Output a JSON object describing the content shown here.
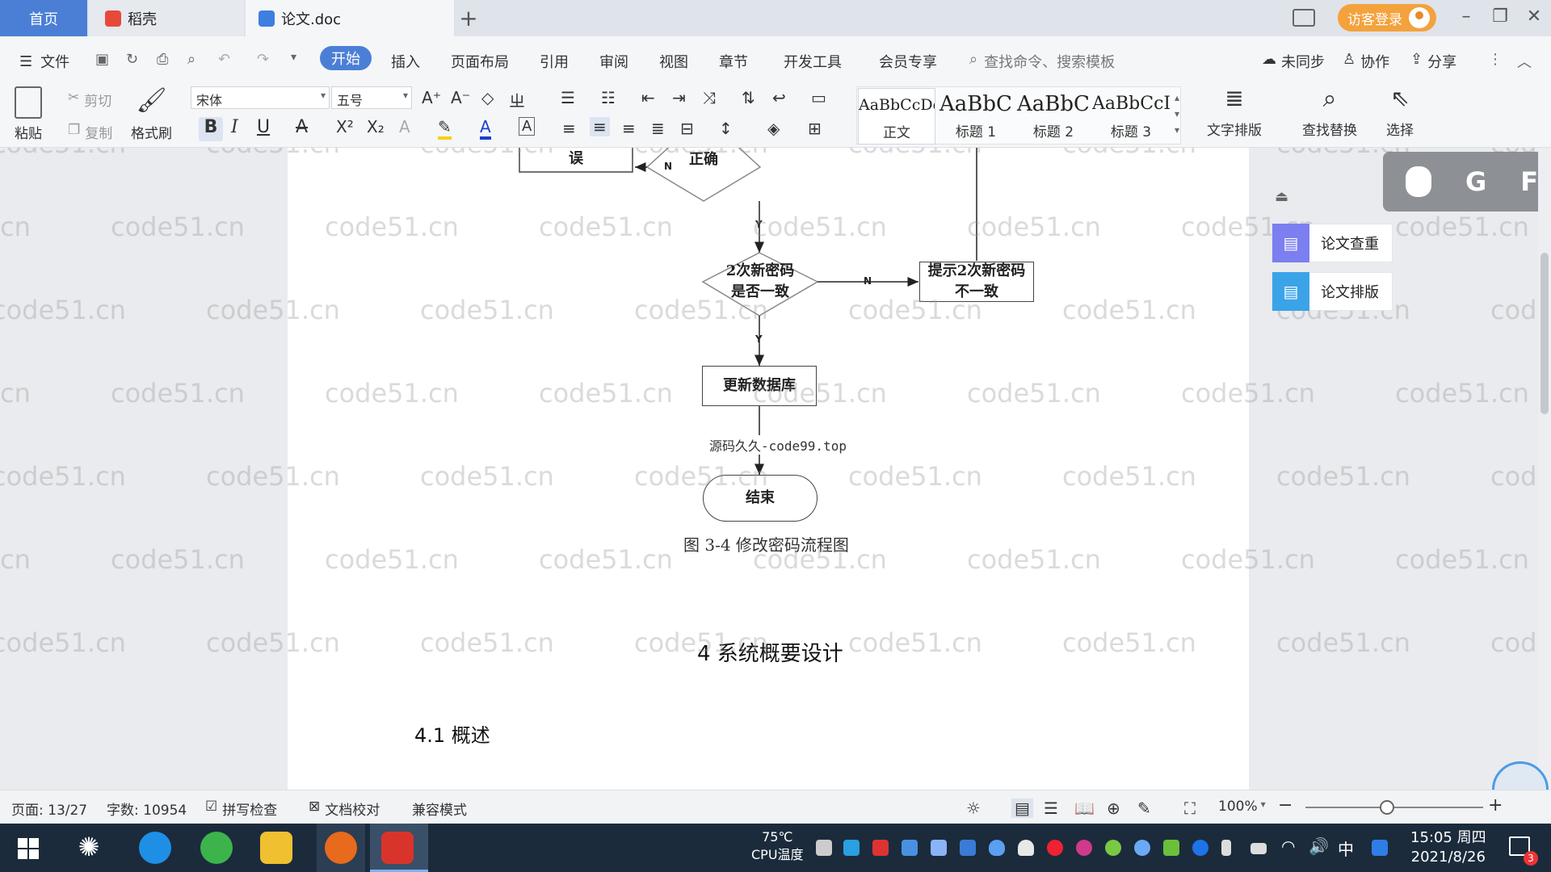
{
  "tabs": {
    "home": "首页",
    "daoke": "稻壳",
    "doc": "论文.doc",
    "add": "+"
  },
  "titlebar": {
    "login": "访客登录"
  },
  "menu": {
    "file": "文件",
    "items": [
      "开始",
      "插入",
      "页面布局",
      "引用",
      "审阅",
      "视图",
      "章节",
      "开发工具",
      "会员专享"
    ],
    "search_placeholder": "查找命令、搜索模板",
    "sync": "未同步",
    "collab": "协作",
    "share": "分享"
  },
  "ribbon": {
    "paste": "粘贴",
    "cut": "剪切",
    "copy": "复制",
    "format_painter": "格式刷",
    "font_name": "宋体",
    "font_size": "五号",
    "styles": [
      {
        "sample": "AaBbCcDd",
        "label": "正文"
      },
      {
        "sample": "AaBbC",
        "label": "标题 1"
      },
      {
        "sample": "AaBbC",
        "label": "标题 2"
      },
      {
        "sample": "AaBbCcI",
        "label": "标题 3"
      }
    ],
    "text_layout": "文字排版",
    "find_replace": "查找替换",
    "select": "选择"
  },
  "watermark": "code51.cn",
  "flowchart": {
    "top_box": "误",
    "top_diamond": "正确",
    "diamond2": "2次新密码\n是否一致",
    "alert_box": "提示2次新密码\n不一致",
    "update_box": "更新数据库",
    "end": "结束",
    "label_y": "Y",
    "label_n": "N",
    "source_note": "源码久久-code99.top"
  },
  "document": {
    "figure_caption": "图 3-4 修改密码流程图",
    "heading": "4 系统概要设计",
    "subheading": "4.1 概述"
  },
  "side_panel": {
    "check": "论文查重",
    "layout": "论文排版"
  },
  "overlay_letters": [
    "G",
    "F"
  ],
  "status": {
    "page": "页面: 13/27",
    "words": "字数: 10954",
    "spell": "拼写检查",
    "proof": "文档校对",
    "compat": "兼容模式",
    "zoom": "100%"
  },
  "taskbar": {
    "temp": "75℃",
    "temp_label": "CPU温度",
    "time": "15:05 周四",
    "date": "2021/8/26",
    "notify_count": "3",
    "ime": "中"
  },
  "colors": {
    "accent": "#4b7fd6",
    "login": "#f4a23c",
    "taskbar": "#1b2b3c"
  }
}
